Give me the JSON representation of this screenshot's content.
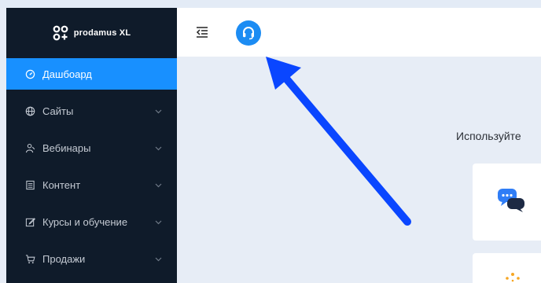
{
  "app": {
    "logo_text": "prodamus XL"
  },
  "sidebar": {
    "items": [
      {
        "label": "Дашбоард",
        "icon": "dashboard-icon",
        "active": true
      },
      {
        "label": "Сайты",
        "icon": "globe-icon"
      },
      {
        "label": "Вебинары",
        "icon": "webinar-icon"
      },
      {
        "label": "Контент",
        "icon": "content-icon"
      },
      {
        "label": "Курсы и обучение",
        "icon": "edit-icon"
      },
      {
        "label": "Продажи",
        "icon": "cart-icon"
      }
    ]
  },
  "header": {
    "menu_icon": "collapse-menu-icon",
    "support_icon": "headset-icon"
  },
  "main": {
    "hint_text": "Используйте"
  },
  "colors": {
    "sidebar_bg": "#0f1b2a",
    "active_item": "#1890ff",
    "support_button": "#1c8cf3",
    "arrow": "#0a46ff",
    "page_bg": "#e7edf6"
  }
}
